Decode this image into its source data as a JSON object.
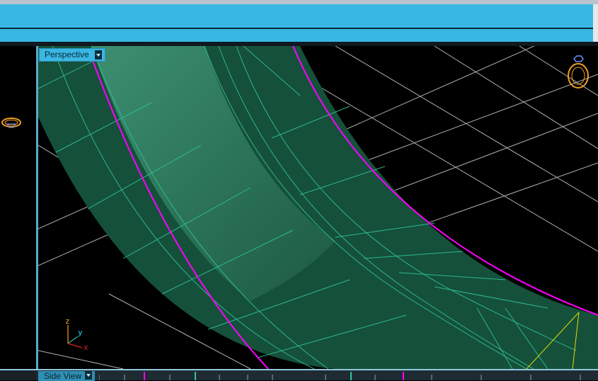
{
  "viewport": {
    "label": "Perspective",
    "menu_icon": "chevron-down-icon"
  },
  "bottom_viewport": {
    "label": "Side View",
    "menu_icon": "chevron-down-icon"
  },
  "axis_tripod": {
    "z": "z",
    "y": "y",
    "x": "x"
  },
  "icons": {
    "left_gizmo": "ring-gizmo-icon",
    "right_gizmo": "ring-gizmo-icon"
  },
  "colors": {
    "ribbon": "#36b8e3",
    "mesh_fill": "#15503a",
    "mesh_highlight": "#3a8a6c",
    "wireframe": "#2fc29a",
    "selection_edge": "#ff00ff",
    "grid": "#d0d0d0",
    "gizmo": "#f0a020"
  }
}
